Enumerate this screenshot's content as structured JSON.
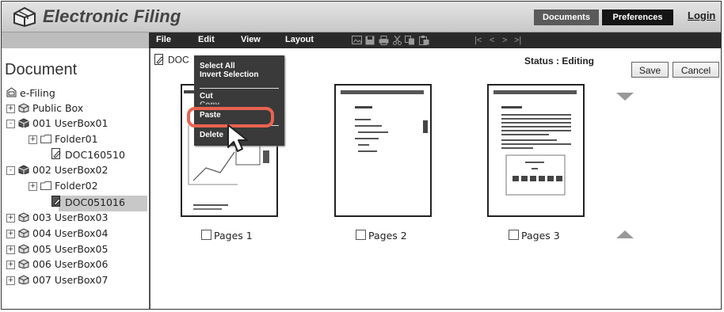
{
  "header": {
    "app_title": "Electronic Filing",
    "documents_label": "Documents",
    "preferences_label": "Preferences",
    "login_label": "Login"
  },
  "menubar": {
    "items": [
      "File",
      "Edit",
      "View",
      "Layout"
    ],
    "toolbar_icons": [
      "image-icon",
      "save-icon",
      "print-icon",
      "cut-icon",
      "copy-icon",
      "paste-icon"
    ],
    "nav_labels": [
      "|<",
      "<",
      ">",
      ">|"
    ]
  },
  "sidebar": {
    "title": "Document",
    "tree": [
      {
        "label": "e-Filing",
        "icon": "efiling-root-icon"
      },
      {
        "label": "Public Box",
        "icon": "public-box-icon",
        "toggle": "+"
      },
      {
        "label": "001 UserBox01",
        "icon": "userbox-icon",
        "toggle": "-"
      },
      {
        "label": "Folder01",
        "icon": "folder-icon",
        "toggle": "+"
      },
      {
        "label": "DOC160510",
        "icon": "document-icon"
      },
      {
        "label": "002 UserBox02",
        "icon": "userbox-icon",
        "toggle": "-"
      },
      {
        "label": "Folder02",
        "icon": "folder-icon",
        "toggle": "+"
      },
      {
        "label": "DOC051016",
        "icon": "document-icon",
        "selected": true
      },
      {
        "label": "003 UserBox03",
        "icon": "userbox-icon",
        "toggle": "+"
      },
      {
        "label": "004 UserBox04",
        "icon": "userbox-icon",
        "toggle": "+"
      },
      {
        "label": "005 UserBox05",
        "icon": "userbox-icon",
        "toggle": "+"
      },
      {
        "label": "006 UserBox06",
        "icon": "userbox-icon",
        "toggle": "+"
      },
      {
        "label": "007 UserBox07",
        "icon": "userbox-icon",
        "toggle": "+"
      }
    ]
  },
  "main": {
    "doc_prefix": "DOC",
    "status": "Status : Editing",
    "save_label": "Save",
    "cancel_label": "Cancel",
    "pages": [
      {
        "label": "Pages 1"
      },
      {
        "label": "Pages 2"
      },
      {
        "label": "Pages 3"
      }
    ]
  },
  "context_menu": {
    "items": [
      "Select All",
      "Invert Selection",
      "Cut",
      "Copy",
      "Paste",
      "Delete"
    ],
    "highlighted": "Paste"
  },
  "colors": {
    "highlight": "#e8634f",
    "menubar": "#2a2a2a",
    "selected_row": "#c8c8c8"
  }
}
